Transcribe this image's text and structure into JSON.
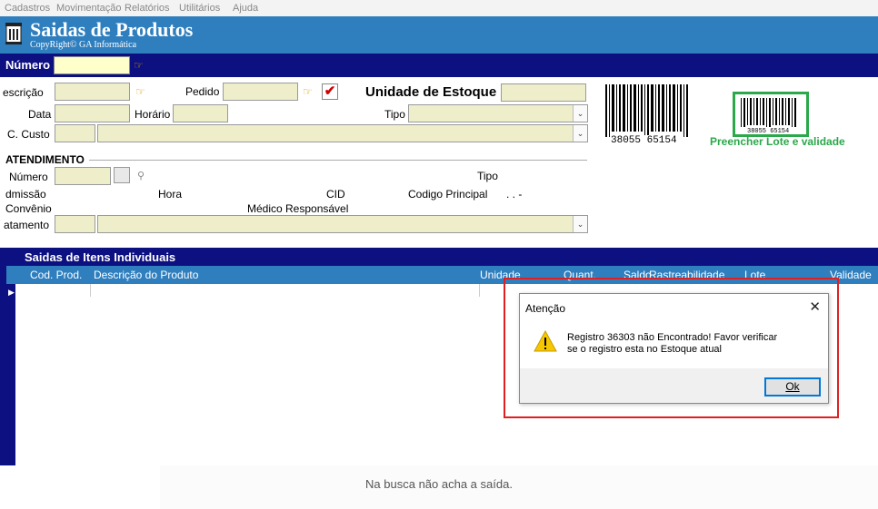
{
  "menu": [
    "Cadastros",
    "Movimentação",
    "Relatórios",
    "Utilitários",
    "Ajuda"
  ],
  "app": {
    "title": "Saidas de Produtos",
    "copyright": "CopyRight© GA Informática"
  },
  "header": {
    "numero_label": "Número"
  },
  "form": {
    "prescricao_label": "escrição",
    "pedido_label": "Pedido",
    "unidade_label": "Unidade de Estoque",
    "data_label": "Data",
    "horario_label": "Horário",
    "tipo_label": "Tipo",
    "ccusto_label": "C. Custo",
    "barcode_text": "38055 65154",
    "barcode_small_text": "38055 65154",
    "lote_label": "Preencher Lote e validade"
  },
  "atendimento": {
    "section_title": "ATENDIMENTO",
    "numero_label": "Número",
    "tipo_label": "Tipo",
    "admissao_label": "dmissão",
    "hora_label": "Hora",
    "cid_label": "CID",
    "codigo_principal_label": "Codigo Principal",
    "codigo_principal_value": ". . -",
    "convenio_label": "Convênio",
    "medico_label": "Médico Responsável",
    "tratamento_label": "atamento"
  },
  "grid": {
    "title": "Saidas de Itens Individuais",
    "columns": [
      "Cod. Prod.",
      "Descrição do Produto",
      "Unidade",
      "Quant.",
      "Saldo",
      "Rastreabilidade",
      "Lote",
      "Validade"
    ]
  },
  "dialog": {
    "title": "Atenção",
    "message_line1": "Registro 36303 não Encontrado! Favor verificar",
    "message_line2": "se o registro esta no Estoque atual",
    "ok_label": "Ok"
  },
  "caption": "Na busca não acha a saída.",
  "colors": {
    "title_bar": "#2f7fbf",
    "dark_bar": "#0d1080",
    "input_bg": "#eeeecb",
    "highlight_input": "#ffffcc",
    "barcode_frame": "#2aa84a",
    "annotation_red": "#e02020"
  },
  "icons": [
    "building-icon",
    "pointing-hand-icon",
    "check-icon",
    "calendar-icon",
    "binoculars-icon",
    "warning-icon",
    "close-icon",
    "dropdown-arrow-icon"
  ]
}
